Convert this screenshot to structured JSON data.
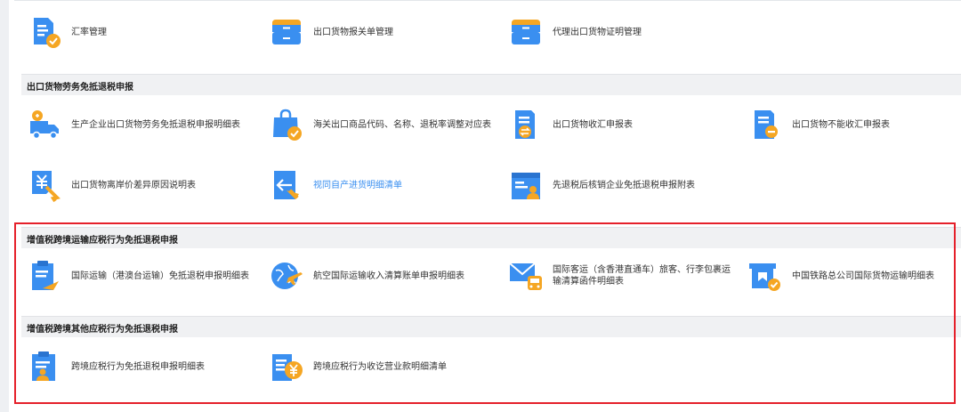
{
  "sections": [
    {
      "title": "出口货物劳务免抵退税申报"
    },
    {
      "title": "增值税跨境运输应税行为免抵退税申报"
    },
    {
      "title": "增值税跨境其他应税行为免抵退税申报"
    }
  ],
  "items": [
    {
      "label": "汇率管理",
      "icon": "document-check-icon"
    },
    {
      "label": "出口货物报关单管理",
      "icon": "drawer-icon"
    },
    {
      "label": "代理出口货物证明管理",
      "icon": "drawer-icon"
    },
    {
      "label": "生产企业出口货物劳务免抵退税申报明细表",
      "icon": "truck-icon"
    },
    {
      "label": "海关出口商品代码、名称、退税率调整对应表",
      "icon": "shopping-bag-check-icon"
    },
    {
      "label": "出口货物收汇申报表",
      "icon": "document-exchange-icon"
    },
    {
      "label": "出口货物不能收汇申报表",
      "icon": "document-minus-icon"
    },
    {
      "label": "出口货物离岸价差异原因说明表",
      "icon": "yuan-cursor-icon"
    },
    {
      "label": "视同自产进货明细清单",
      "icon": "document-arrow-icon"
    },
    {
      "label": "先退税后核销企业免抵退税申报附表",
      "icon": "calendar-user-icon"
    },
    {
      "label": "国际运输（港澳台运输）免抵退税申报明细表",
      "icon": "clipboard-plane-icon"
    },
    {
      "label": "航空国际运输收入清算账单申报明细表",
      "icon": "globe-plane-icon"
    },
    {
      "label": "国际客运（含香港直通车）旅客、行李包裹运输清算函件明细表",
      "icon": "mail-bus-icon"
    },
    {
      "label": "中国铁路总公司国际货物运输明细表",
      "icon": "board-check-icon"
    },
    {
      "label": "跨境应税行为免抵退税申报明细表",
      "icon": "clipboard-user-icon"
    },
    {
      "label": "跨境应税行为收讫营业款明细清单",
      "icon": "document-yuan-icon"
    }
  ],
  "colors": {
    "primary": "#3a8ff0",
    "secondary": "#f5a623",
    "highlight_border": "#e5202a",
    "link": "#3a8ff0"
  }
}
